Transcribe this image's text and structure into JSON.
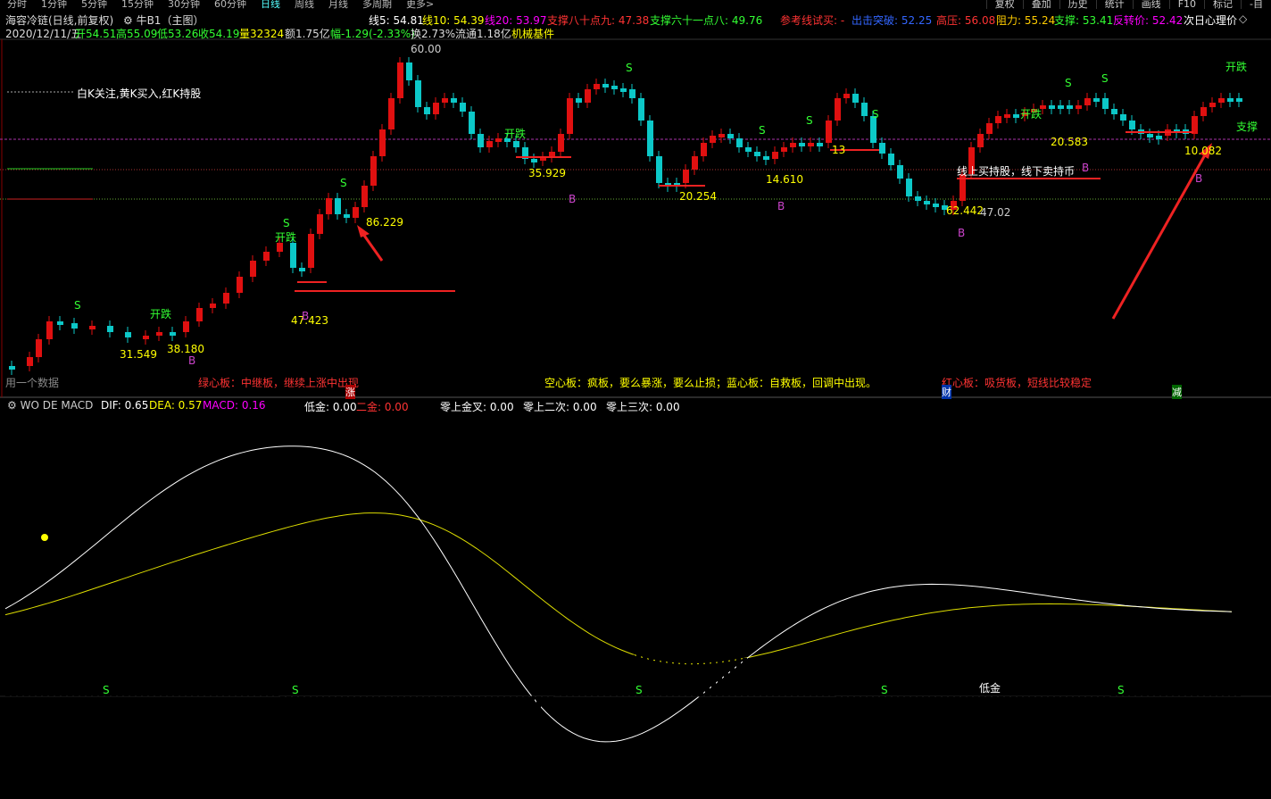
{
  "periods": [
    "分时",
    "1分钟",
    "5分钟",
    "15分钟",
    "30分钟",
    "60分钟",
    "日线",
    "周线",
    "月线",
    "多周期",
    "更多>"
  ],
  "active_period": "日线",
  "right_tools": [
    "复权",
    "叠加",
    "历史",
    "统计",
    "画线",
    "F10",
    "标记",
    "-自"
  ],
  "stock": {
    "name": "海容冷链(日线,前复权)",
    "title": "牛B1（主图）"
  },
  "ma": {
    "ma5": "线5: 54.81",
    "ma10": "线10: 54.39",
    "ma20": "线20: 53.97",
    "s1": "支撑八十点九: 47.38",
    "s2": "支撑六十一点八: 49.76",
    "ref": "参考线试买: -",
    "ex": "出击突破: 52.25",
    "hi": "高压: 56.08",
    "res": "阻力: 55.24",
    "sup": "支撑: 53.41",
    "rev": "反转价: 52.42",
    "next": "次日心理价"
  },
  "ohlc": {
    "date": "2020/12/11/五",
    "open": "开54.51",
    "high": "高55.09",
    "low": "低53.26",
    "close": "收54.19",
    "vol": "量32324",
    "amt": "额1.75亿",
    "chg": "幅-1.29(-2.33%)",
    "turn": "换2.73%",
    "float": "流通1.18亿",
    "sector": "机械基件"
  },
  "notes": {
    "legend": "白K关注,黄K买入,红K持股",
    "green": "绿心板：中继板，继续上涨中出现",
    "hollow": "空心板：疯板，要么暴涨，要么止损；蓝心板：自救板，回调中出现。",
    "red": "红心板：吸货板，短线比较稳定",
    "line": "线上买持股，线下卖持币",
    "loading": "用一个数据"
  },
  "markers": {
    "zhang": "涨",
    "cai": "财",
    "jian": "减"
  },
  "price_labels": [
    "60.00",
    "86.229",
    "47.423",
    "31.549",
    "38.180",
    "35.929",
    "20.254",
    "14.610",
    "20.583",
    "10.082",
    "62.442",
    "47.02",
    "13"
  ],
  "signals": {
    "open": "开跌",
    "s": "S",
    "b": "B",
    "support": "支撑",
    "low": "低金"
  },
  "macd": {
    "name": "WO DE MACD",
    "dif": "DIF: 0.65",
    "dea": "DEA: 0.57",
    "macd": "MACD: 0.16",
    "low": "低金: 0.00",
    "two": "二金: 0.00",
    "z1": "零上金叉: 0.00",
    "z2": "零上二次: 0.00",
    "z3": "零上三次: 0.00"
  },
  "chart_data": {
    "type": "line",
    "note": "K-line candles with MACD sub-chart",
    "ma_labels": [
      "线5",
      "线10",
      "线20"
    ],
    "ylim": [
      10,
      60
    ]
  }
}
